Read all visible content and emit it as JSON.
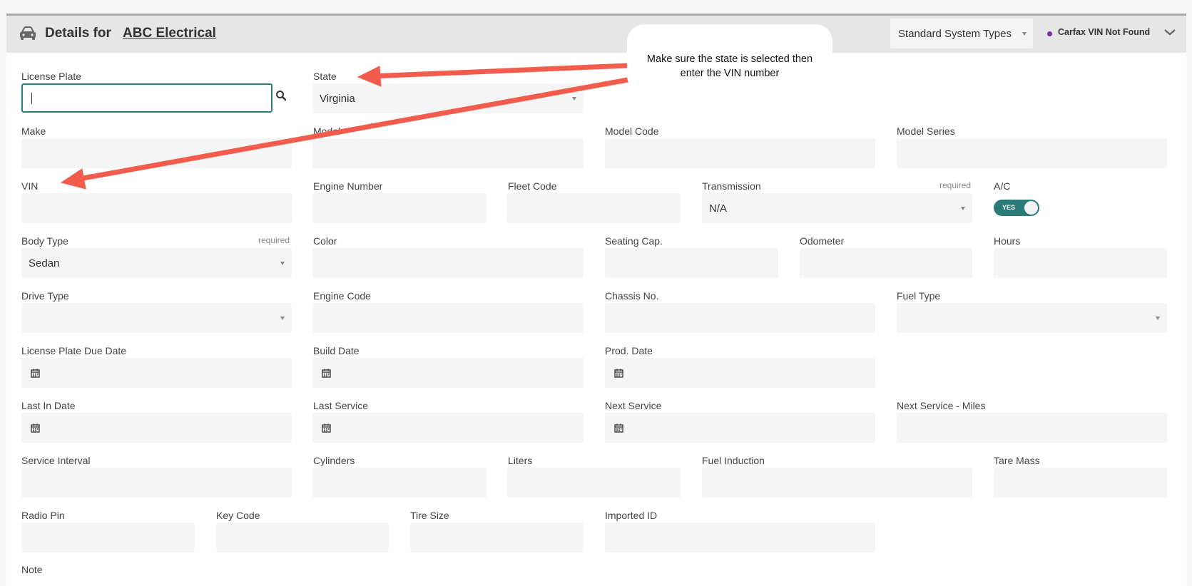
{
  "header": {
    "title_prefix": "Details for",
    "customer_name": "ABC Electrical",
    "system_type_select": "Standard System Types",
    "carfax_status": "Carfax VIN Not Found"
  },
  "annotation": {
    "callout_text": "Make sure the state is selected then enter the VIN number",
    "arrow_color": "#f25c4d"
  },
  "form": {
    "license_plate": {
      "label": "License Plate",
      "value": ""
    },
    "state": {
      "label": "State",
      "value": "Virginia"
    },
    "make": {
      "label": "Make"
    },
    "model": {
      "label": "Model"
    },
    "model_code": {
      "label": "Model Code"
    },
    "model_series": {
      "label": "Model Series"
    },
    "vin": {
      "label": "VIN"
    },
    "engine_number": {
      "label": "Engine Number"
    },
    "fleet_code": {
      "label": "Fleet Code"
    },
    "transmission": {
      "label": "Transmission",
      "required": "required",
      "value": "N/A"
    },
    "ac": {
      "label": "A/C",
      "toggle": "YES"
    },
    "body_type": {
      "label": "Body Type",
      "required": "required",
      "value": "Sedan"
    },
    "color": {
      "label": "Color"
    },
    "seating_cap": {
      "label": "Seating Cap."
    },
    "odometer": {
      "label": "Odometer"
    },
    "hours": {
      "label": "Hours"
    },
    "drive_type": {
      "label": "Drive Type"
    },
    "engine_code": {
      "label": "Engine Code"
    },
    "chassis_no": {
      "label": "Chassis No."
    },
    "fuel_type": {
      "label": "Fuel Type"
    },
    "license_plate_due_date": {
      "label": "License Plate Due Date"
    },
    "build_date": {
      "label": "Build Date"
    },
    "prod_date": {
      "label": "Prod. Date"
    },
    "last_in_date": {
      "label": "Last In Date"
    },
    "last_service": {
      "label": "Last Service"
    },
    "next_service": {
      "label": "Next Service"
    },
    "next_service_miles": {
      "label": "Next Service - Miles"
    },
    "service_interval": {
      "label": "Service Interval"
    },
    "cylinders": {
      "label": "Cylinders"
    },
    "liters": {
      "label": "Liters"
    },
    "fuel_induction": {
      "label": "Fuel Induction"
    },
    "tare_mass": {
      "label": "Tare Mass"
    },
    "radio_pin": {
      "label": "Radio Pin"
    },
    "key_code": {
      "label": "Key Code"
    },
    "tire_size": {
      "label": "Tire Size"
    },
    "imported_id": {
      "label": "Imported ID"
    },
    "note": {
      "label": "Note"
    }
  }
}
